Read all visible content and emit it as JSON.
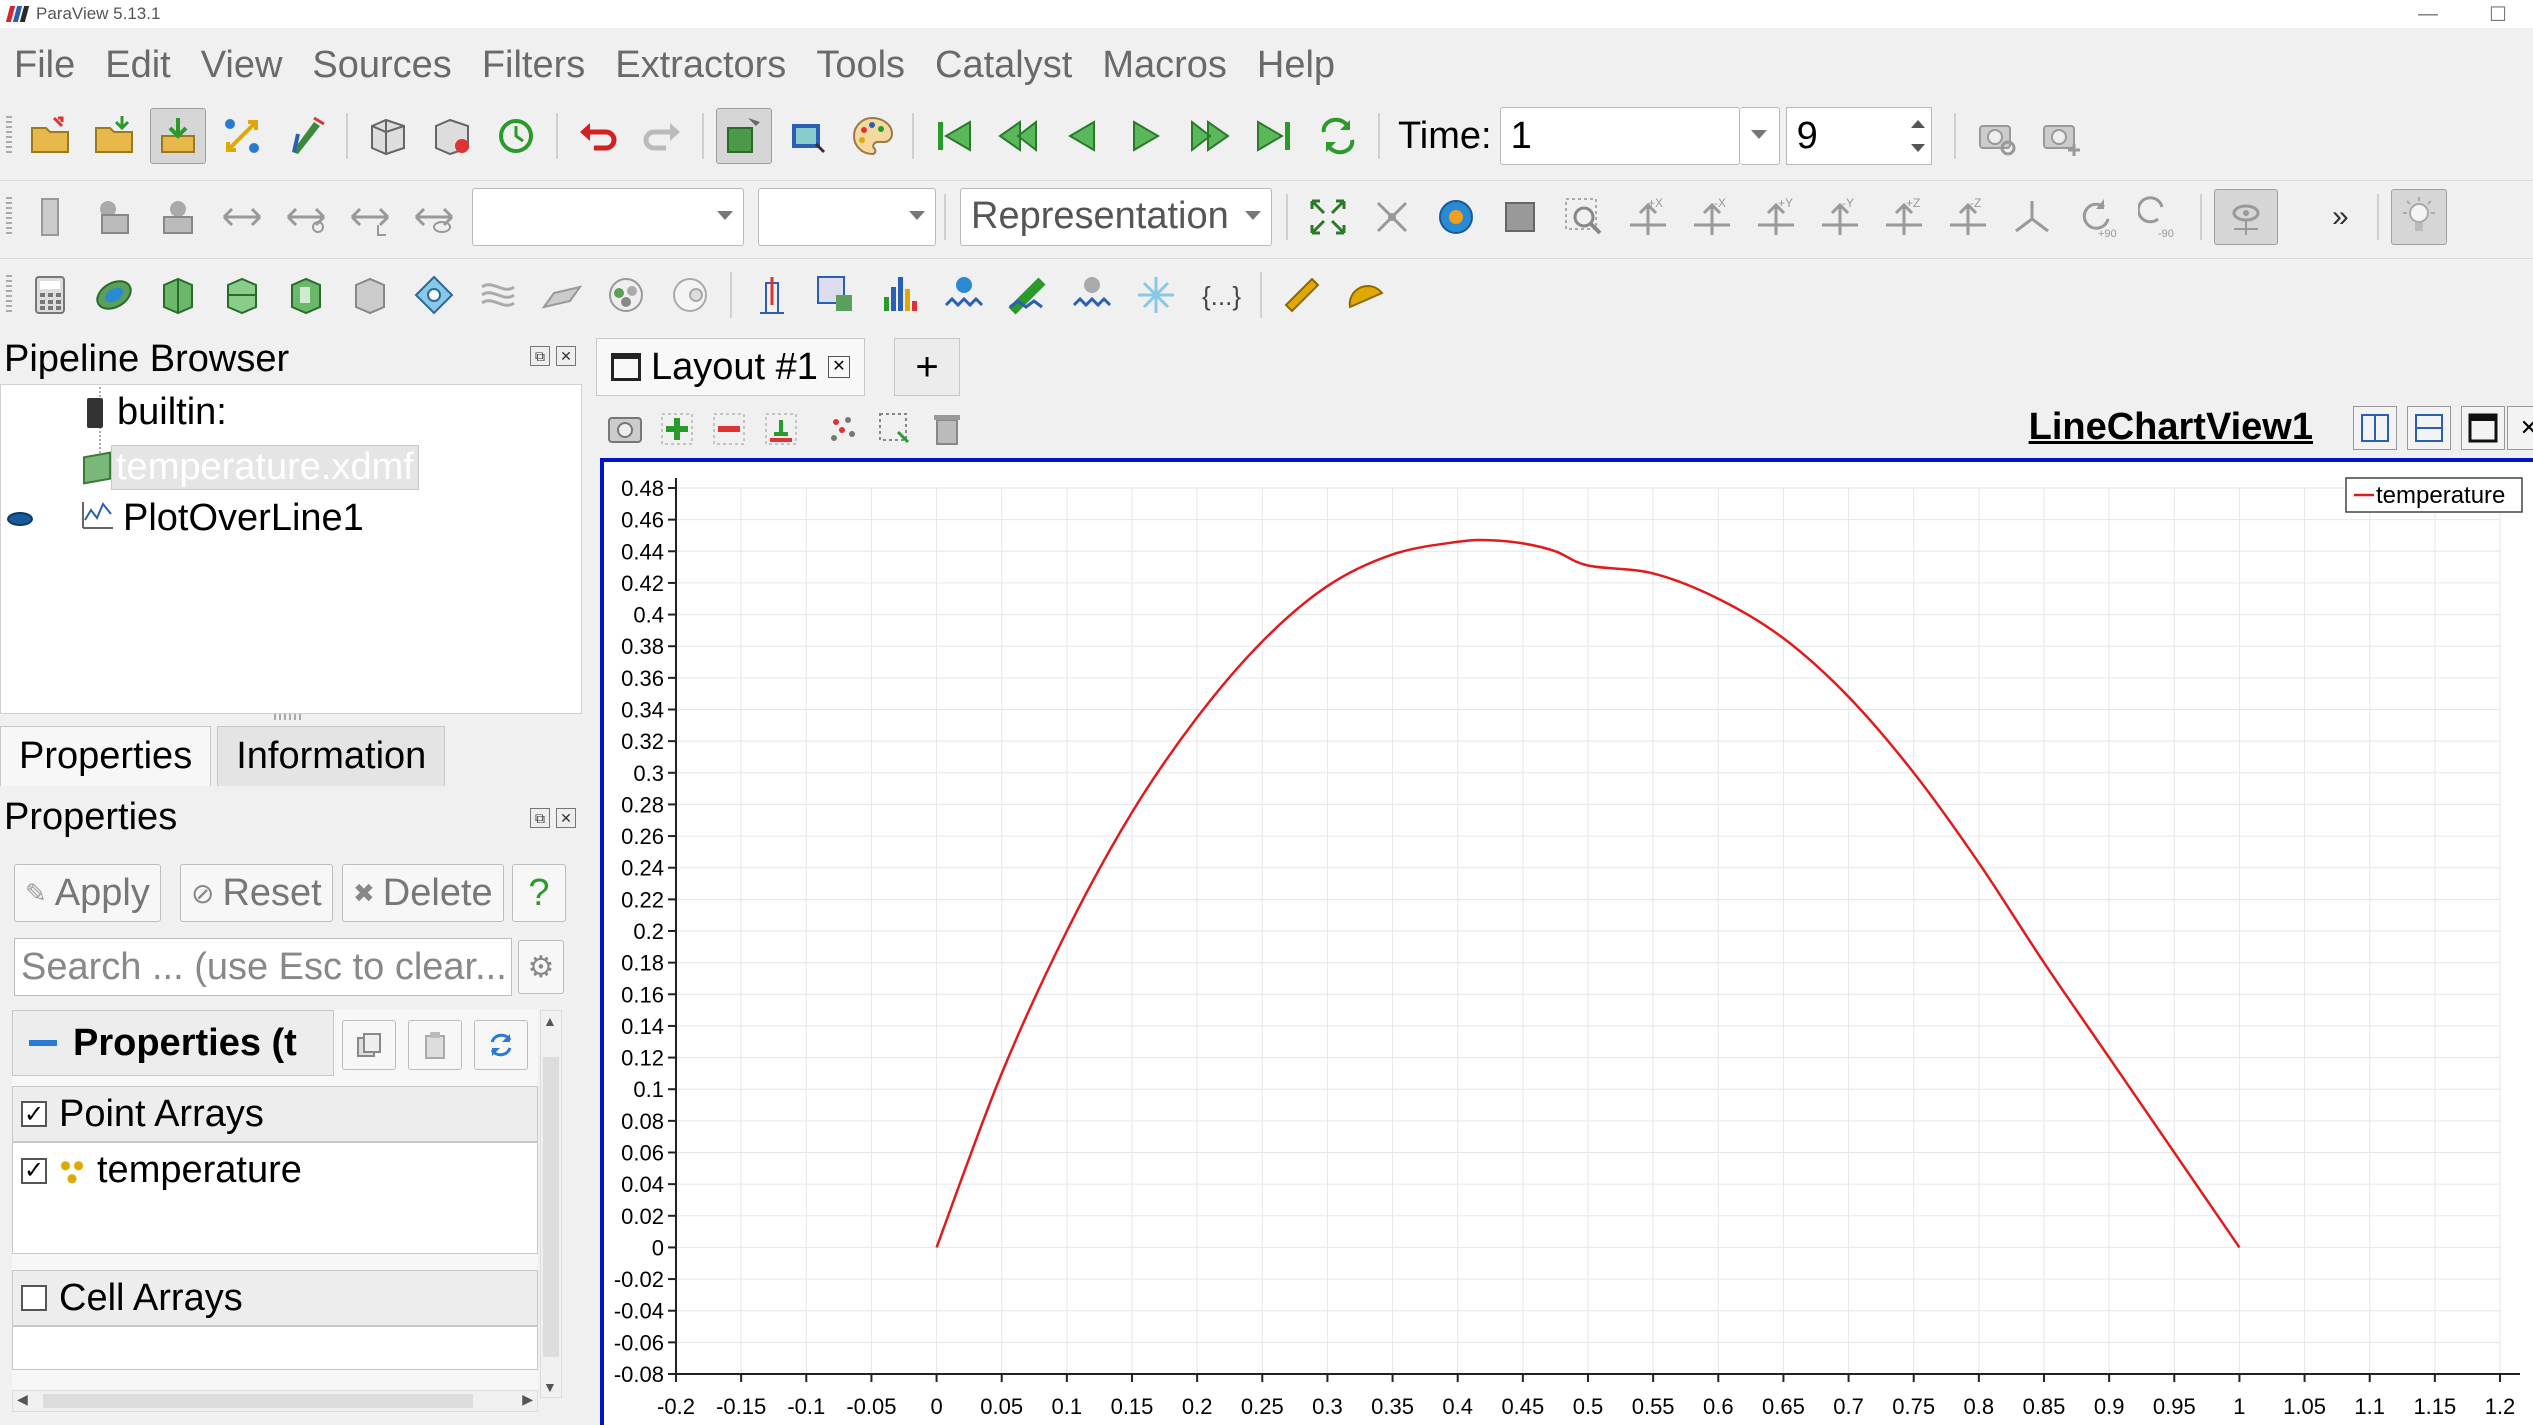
{
  "titlebar": {
    "title": "ParaView 5.13.1",
    "minimize": "—",
    "maximize": "☐"
  },
  "menu": [
    "File",
    "Edit",
    "View",
    "Sources",
    "Filters",
    "Extractors",
    "Tools",
    "Catalyst",
    "Macros",
    "Help"
  ],
  "toolbar": {
    "time_label": "Time:",
    "time_value": "1",
    "timestep_value": "9",
    "representation": "Representation",
    "overflow": "»"
  },
  "pipeline_browser": {
    "title": "Pipeline Browser",
    "items": [
      {
        "label": "builtin:"
      },
      {
        "label": "temperature.xdmf"
      },
      {
        "label": "PlotOverLine1"
      }
    ]
  },
  "properties_panel": {
    "tabs": [
      "Properties",
      "Information"
    ],
    "title": "Properties",
    "apply": "Apply",
    "reset": "Reset",
    "delete": "Delete",
    "help": "?",
    "search_placeholder": "Search ... (use Esc to clear...",
    "section_title": "Properties (t",
    "point_arrays_label": "Point Arrays",
    "point_array_item": "temperature",
    "cell_arrays_label": "Cell Arrays"
  },
  "layout": {
    "tab_label": "Layout #1",
    "add_tab": "+",
    "view_title": "LineChartView1"
  },
  "chart_data": {
    "type": "line",
    "legend_position": "top-right",
    "grid": true,
    "xlim": [
      -0.2,
      1.2
    ],
    "ylim": [
      -0.08,
      0.48
    ],
    "x_ticks": [
      "-0.2",
      "-0.15",
      "-0.1",
      "-0.05",
      "0",
      "0.05",
      "0.1",
      "0.15",
      "0.2",
      "0.25",
      "0.3",
      "0.35",
      "0.4",
      "0.45",
      "0.5",
      "0.55",
      "0.6",
      "0.65",
      "0.7",
      "0.75",
      "0.8",
      "0.85",
      "0.9",
      "0.95",
      "1",
      "1.05",
      "1.1",
      "1.15",
      "1.2"
    ],
    "y_ticks": [
      "0.48",
      "0.46",
      "0.44",
      "0.42",
      "0.4",
      "0.38",
      "0.36",
      "0.34",
      "0.32",
      "0.3",
      "0.28",
      "0.26",
      "0.24",
      "0.22",
      "0.2",
      "0.18",
      "0.16",
      "0.14",
      "0.12",
      "0.1",
      "0.08",
      "0.06",
      "0.04",
      "0.02",
      "0",
      "-0.02",
      "-0.04",
      "-0.06",
      "-0.08"
    ],
    "series": [
      {
        "name": "temperature",
        "color": "#e31a1c",
        "x": [
          0,
          0.05,
          0.1,
          0.15,
          0.2,
          0.25,
          0.3,
          0.35,
          0.4,
          0.425,
          0.45,
          0.475,
          0.5,
          0.55,
          0.6,
          0.65,
          0.7,
          0.75,
          0.8,
          0.85,
          0.9,
          0.95,
          1
        ],
        "y": [
          0,
          0.11,
          0.2,
          0.275,
          0.335,
          0.383,
          0.418,
          0.438,
          0.446,
          0.447,
          0.445,
          0.44,
          0.431,
          0.426,
          0.41,
          0.385,
          0.348,
          0.3,
          0.243,
          0.18,
          0.12,
          0.06,
          0
        ]
      }
    ]
  }
}
